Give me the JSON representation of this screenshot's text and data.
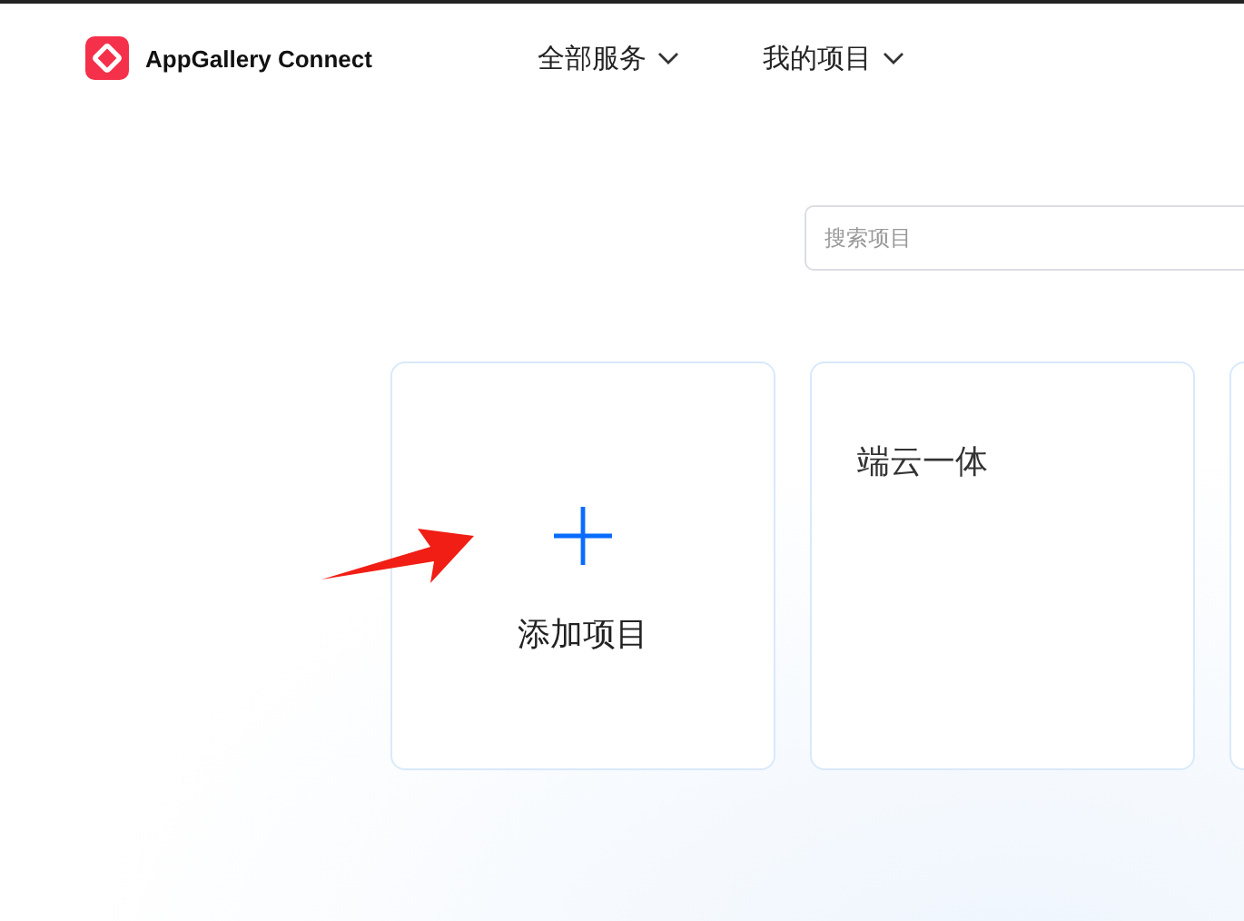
{
  "header": {
    "brand": "AppGallery Connect",
    "nav": [
      {
        "label": "全部服务"
      },
      {
        "label": "我的项目"
      }
    ]
  },
  "search": {
    "placeholder": "搜索项目"
  },
  "projects": [
    {
      "kind": "add",
      "label": "添加项目"
    },
    {
      "kind": "project",
      "name": "端云一体"
    },
    {
      "kind": "project"
    }
  ]
}
